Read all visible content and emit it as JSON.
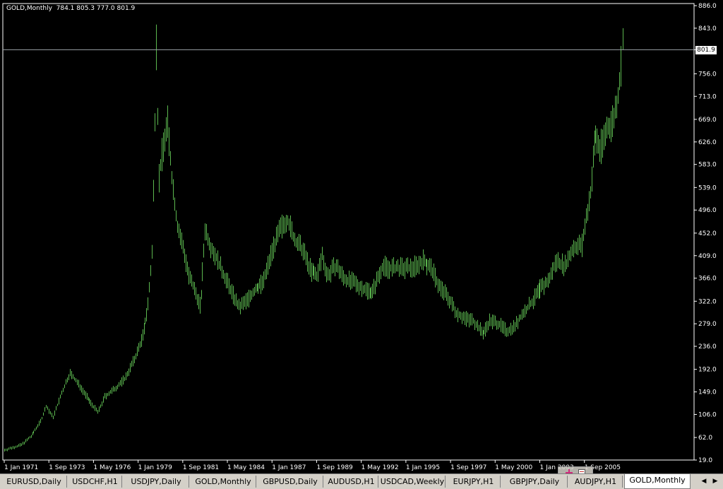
{
  "header": {
    "symbol_label": "GOLD,Monthly  784.1 805.3 777.0 801.9"
  },
  "current_price_label": "801.9",
  "colors": {
    "background": "#000000",
    "bars": "#5cb84f",
    "price_line": "#9aa0a6",
    "axis": "#ffffff"
  },
  "chart_data": {
    "type": "ohlc",
    "symbol": "GOLD",
    "timeframe": "Monthly",
    "last_bar": {
      "open": 784.1,
      "high": 805.3,
      "low": 777.0,
      "close": 801.9
    },
    "current_price": 801.9,
    "ylim": [
      19.0,
      886.0
    ],
    "y_ticks": [
      "886.0",
      "843.0",
      "801.9",
      "756.0",
      "713.0",
      "669.0",
      "626.0",
      "583.0",
      "539.0",
      "496.0",
      "452.0",
      "409.0",
      "366.0",
      "322.0",
      "279.0",
      "236.0",
      "192.0",
      "149.0",
      "106.0",
      "62.0",
      "19.0"
    ],
    "x_ticks": [
      "1 Jan 1971",
      "1 Sep 1973",
      "1 May 1976",
      "1 Jan 1979",
      "1 Sep 1981",
      "1 May 1984",
      "1 Jan 1987",
      "1 Sep 1989",
      "1 May 1992",
      "1 Jan 1995",
      "1 Sep 1997",
      "1 May 2000",
      "1 Jan 2003",
      "1 Sep 2005"
    ],
    "x_tick_times": [
      1971.0,
      1973.667,
      1976.333,
      1979.0,
      1981.667,
      1984.333,
      1987.0,
      1989.667,
      1992.333,
      1995.0,
      1997.667,
      2000.333,
      2003.0,
      2005.667
    ],
    "x_range": [
      1971.0,
      2008.0
    ],
    "price_path": [
      [
        1971.0,
        38
      ],
      [
        1972.0,
        48
      ],
      [
        1972.6,
        65
      ],
      [
        1973.2,
        95
      ],
      [
        1973.5,
        122
      ],
      [
        1973.9,
        100
      ],
      [
        1974.4,
        145
      ],
      [
        1974.9,
        185
      ],
      [
        1975.5,
        160
      ],
      [
        1976.0,
        135
      ],
      [
        1976.6,
        110
      ],
      [
        1977.0,
        140
      ],
      [
        1977.6,
        155
      ],
      [
        1978.2,
        175
      ],
      [
        1978.8,
        215
      ],
      [
        1979.3,
        260
      ],
      [
        1979.6,
        320
      ],
      [
        1979.85,
        420
      ],
      [
        1980.0,
        670
      ],
      [
        1980.08,
        800
      ],
      [
        1980.25,
        560
      ],
      [
        1980.5,
        620
      ],
      [
        1980.75,
        660
      ],
      [
        1981.0,
        560
      ],
      [
        1981.3,
        470
      ],
      [
        1981.7,
        420
      ],
      [
        1982.0,
        370
      ],
      [
        1982.5,
        330
      ],
      [
        1982.7,
        310
      ],
      [
        1983.0,
        460
      ],
      [
        1983.3,
        430
      ],
      [
        1983.6,
        410
      ],
      [
        1984.0,
        380
      ],
      [
        1984.5,
        345
      ],
      [
        1985.0,
        310
      ],
      [
        1985.5,
        325
      ],
      [
        1986.0,
        345
      ],
      [
        1986.5,
        360
      ],
      [
        1987.0,
        420
      ],
      [
        1987.5,
        460
      ],
      [
        1987.9,
        480
      ],
      [
        1988.3,
        440
      ],
      [
        1988.8,
        420
      ],
      [
        1989.3,
        380
      ],
      [
        1989.7,
        370
      ],
      [
        1990.0,
        410
      ],
      [
        1990.3,
        370
      ],
      [
        1990.8,
        390
      ],
      [
        1991.3,
        365
      ],
      [
        1992.0,
        355
      ],
      [
        1992.5,
        345
      ],
      [
        1993.0,
        340
      ],
      [
        1993.6,
        390
      ],
      [
        1994.0,
        385
      ],
      [
        1994.6,
        385
      ],
      [
        1995.2,
        385
      ],
      [
        1995.6,
        390
      ],
      [
        1996.0,
        400
      ],
      [
        1996.5,
        385
      ],
      [
        1997.0,
        350
      ],
      [
        1997.5,
        330
      ],
      [
        1998.0,
        300
      ],
      [
        1998.5,
        290
      ],
      [
        1999.0,
        285
      ],
      [
        1999.6,
        260
      ],
      [
        2000.0,
        285
      ],
      [
        2000.5,
        280
      ],
      [
        2001.0,
        265
      ],
      [
        2001.5,
        275
      ],
      [
        2002.0,
        300
      ],
      [
        2002.5,
        320
      ],
      [
        2003.0,
        345
      ],
      [
        2003.5,
        360
      ],
      [
        2004.0,
        400
      ],
      [
        2004.5,
        390
      ],
      [
        2005.0,
        425
      ],
      [
        2005.5,
        430
      ],
      [
        2006.0,
        530
      ],
      [
        2006.3,
        640
      ],
      [
        2006.6,
        610
      ],
      [
        2007.0,
        650
      ],
      [
        2007.4,
        670
      ],
      [
        2007.7,
        720
      ],
      [
        2007.9,
        801.9
      ]
    ]
  },
  "tabs": [
    "EURUSD,Daily",
    "USDCHF,H1",
    "USDJPY,Daily",
    "GOLD,Monthly",
    "GBPUSD,Daily",
    "AUDUSD,H1",
    "USDCAD,Weekly",
    "EURJPY,H1",
    "GBPJPY,Daily",
    "AUDJPY,H1",
    "GOLD,Monthly"
  ],
  "active_tab_index": 10
}
